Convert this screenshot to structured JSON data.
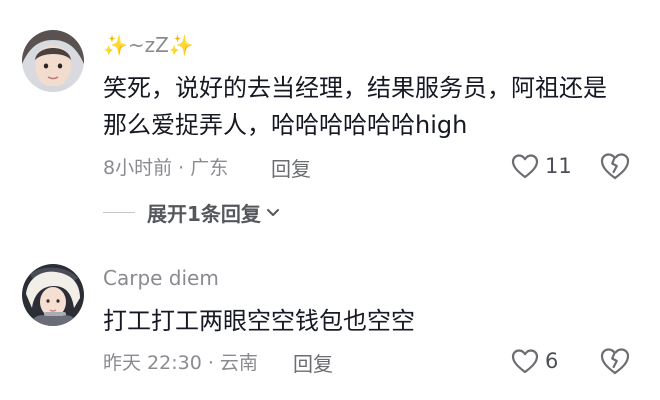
{
  "comments": [
    {
      "username": "✨~zZ✨",
      "text": "笑死，说好的去当经理，结果服务员，阿祖还是那么爱捉弄人，哈哈哈哈哈哈high",
      "meta": "8小时前 · 广东",
      "reply_label": "回复",
      "like_count": "11",
      "expand_label": "展开1条回复",
      "avatar": "child-photo-avatar"
    },
    {
      "username": "Carpe diem",
      "text": "打工打工两眼空空钱包也空空",
      "meta": "昨天 22:30 · 云南",
      "reply_label": "回复",
      "like_count": "6",
      "avatar": "girl-photo-avatar"
    }
  ],
  "icons": {
    "like": "heart-outline-icon",
    "dislike": "broken-heart-icon",
    "expand": "chevron-down-icon"
  },
  "colors": {
    "text": "#161823",
    "secondary": "#8a8b91",
    "icon": "#6b6d72"
  }
}
